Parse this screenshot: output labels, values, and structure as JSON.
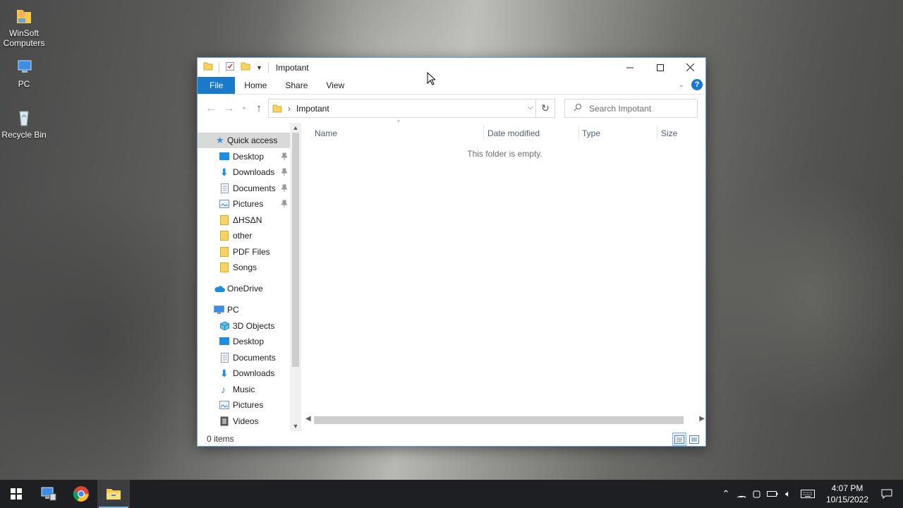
{
  "desktop": {
    "icons": [
      {
        "label": "WinSoft Computers",
        "icon": "folder-user-icon"
      },
      {
        "label": "PC",
        "icon": "pc-icon"
      },
      {
        "label": "Recycle Bin",
        "icon": "recycle-bin-icon"
      }
    ]
  },
  "window": {
    "title": "Impotant",
    "ribbon_tabs": [
      "File",
      "Home",
      "Share",
      "View"
    ],
    "address": "Impotant",
    "search_placeholder": "Search Impotant",
    "columns": [
      "Name",
      "Date modified",
      "Type",
      "Size"
    ],
    "empty_message": "This folder is empty.",
    "status": "0 items",
    "nav": {
      "quick_access": {
        "label": "Quick access",
        "icon": "star-icon"
      },
      "quick_items": [
        {
          "label": "Desktop",
          "icon": "desktop-icon",
          "pinned": true
        },
        {
          "label": "Downloads",
          "icon": "downloads-icon",
          "pinned": true
        },
        {
          "label": "Documents",
          "icon": "documents-icon",
          "pinned": true
        },
        {
          "label": "Pictures",
          "icon": "pictures-icon",
          "pinned": true
        },
        {
          "label": "ΔHSΔN",
          "icon": "folder-icon",
          "pinned": false
        },
        {
          "label": "other",
          "icon": "folder-icon",
          "pinned": false
        },
        {
          "label": "PDF Files",
          "icon": "folder-icon",
          "pinned": false
        },
        {
          "label": "Songs",
          "icon": "folder-icon",
          "pinned": false
        }
      ],
      "onedrive": {
        "label": "OneDrive",
        "icon": "cloud-icon"
      },
      "pc": {
        "label": "PC",
        "icon": "pc-icon"
      },
      "pc_items": [
        {
          "label": "3D Objects",
          "icon": "cube-icon"
        },
        {
          "label": "Desktop",
          "icon": "desktop-icon"
        },
        {
          "label": "Documents",
          "icon": "documents-icon"
        },
        {
          "label": "Downloads",
          "icon": "downloads-icon"
        },
        {
          "label": "Music",
          "icon": "music-icon"
        },
        {
          "label": "Pictures",
          "icon": "pictures-icon"
        },
        {
          "label": "Videos",
          "icon": "videos-icon"
        }
      ]
    }
  },
  "taskbar": {
    "apps": [
      "start-icon",
      "network-computer-icon",
      "chrome-icon",
      "file-explorer-icon"
    ],
    "time": "4:07 PM",
    "date": "10/15/2022"
  },
  "colors": {
    "accent": "#1979ca",
    "folder": "#f6d365",
    "taskbar": "#1d1f22"
  }
}
